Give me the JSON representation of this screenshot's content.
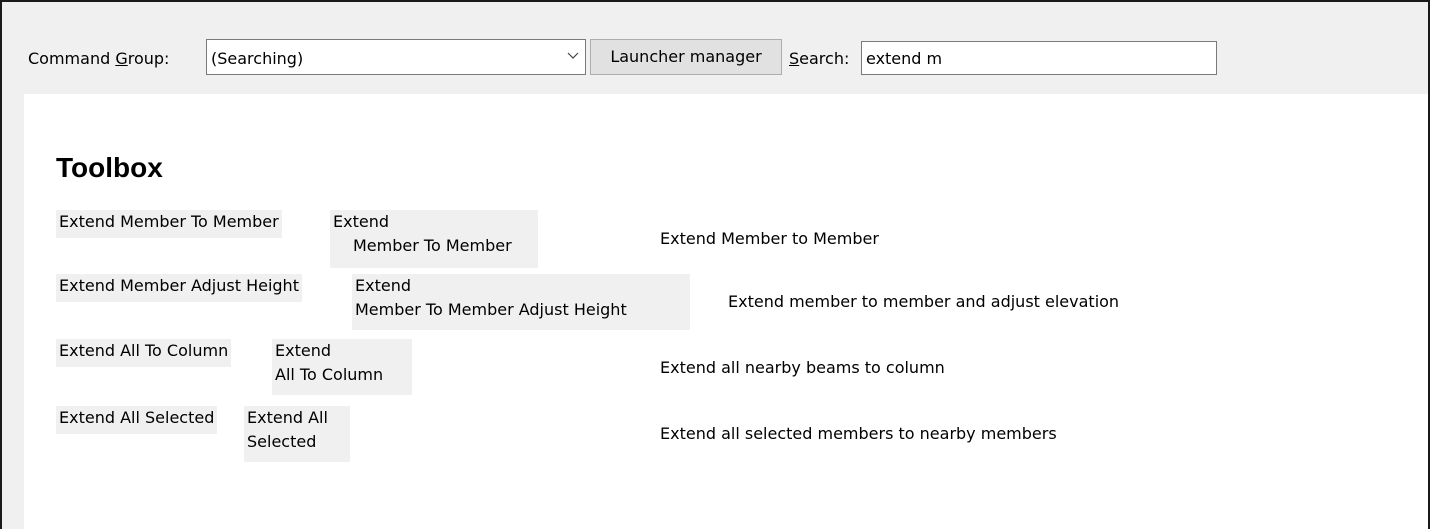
{
  "toolbar": {
    "group_label_pre": "Command ",
    "group_label_u": "G",
    "group_label_post": "roup:",
    "group_value": "(Searching)",
    "launcher_label": "Launcher manager",
    "search_label_u": "S",
    "search_label_post": "earch:",
    "search_value": "extend m"
  },
  "toolbox": {
    "title": "Toolbox",
    "rows": [
      {
        "name": "Extend Member To Member",
        "cmd1": "Extend",
        "cmd2": "Member To Member",
        "desc": "Extend Member to Member"
      },
      {
        "name": "Extend Member Adjust Height",
        "cmd1": "Extend",
        "cmd2": "Member To Member Adjust Height",
        "desc": "Extend member to member and adjust elevation"
      },
      {
        "name": "Extend All To Column",
        "cmd1": "Extend",
        "cmd2": "All To Column",
        "desc": "Extend all nearby beams to column"
      },
      {
        "name": "Extend All Selected",
        "cmd1": "Extend All",
        "cmd2": "Selected",
        "desc": "Extend all selected members to nearby members"
      }
    ]
  }
}
